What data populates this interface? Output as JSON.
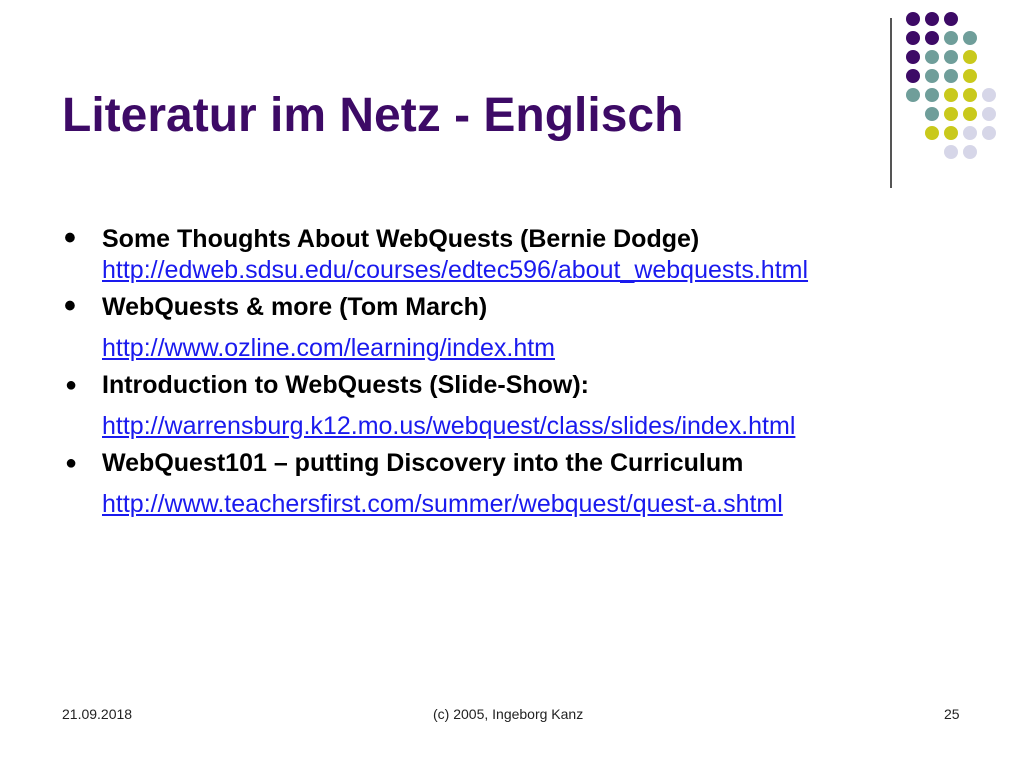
{
  "slide": {
    "title": "Literatur im Netz - Englisch",
    "items": [
      {
        "bullet": "•",
        "label": "Some Thoughts About WebQuests (Bernie Dodge)",
        "link": "http://edweb.sdsu.edu/courses/edtec596/about_webquests.html"
      },
      {
        "bullet": "•",
        "label": "WebQuests & more  (Tom March)",
        "link": "http://www.ozline.com/learning/index.htm"
      },
      {
        "bullet": "●",
        "label": "Introduction to WebQuests (Slide-Show):",
        "link": "http://warrensburg.k12.mo.us/webquest/class/slides/index.html"
      },
      {
        "bullet": "●",
        "label": "WebQuest101 – putting Discovery into the Curriculum",
        "link": "http://www.teachersfirst.com/summer/webquest/quest-a.shtml"
      }
    ]
  },
  "footer": {
    "date": "21.09.2018",
    "copyright": "(c) 2005,  Ingeborg Kanz",
    "page_number": "25"
  },
  "colors": {
    "title": "#3d0a66",
    "link": "#1a1aee",
    "dot_purple": "#3d0a66",
    "dot_teal": "#6f9e9a",
    "dot_yellow": "#c9c91c",
    "dot_lavender": "#d6d6e8"
  },
  "decoration": {
    "dot_rows": [
      [
        "purple",
        "purple",
        "purple"
      ],
      [
        "purple",
        "purple",
        "teal",
        "teal"
      ],
      [
        "purple",
        "teal",
        "teal",
        "yellow"
      ],
      [
        "purple",
        "teal",
        "teal",
        "yellow"
      ],
      [
        "teal",
        "teal",
        "yellow",
        "yellow",
        "lavender"
      ],
      [
        "teal",
        "yellow",
        "yellow",
        "lavender"
      ],
      [
        "yellow",
        "yellow",
        "lavender",
        "lavender"
      ],
      [
        "lavender",
        "lavender"
      ]
    ]
  }
}
